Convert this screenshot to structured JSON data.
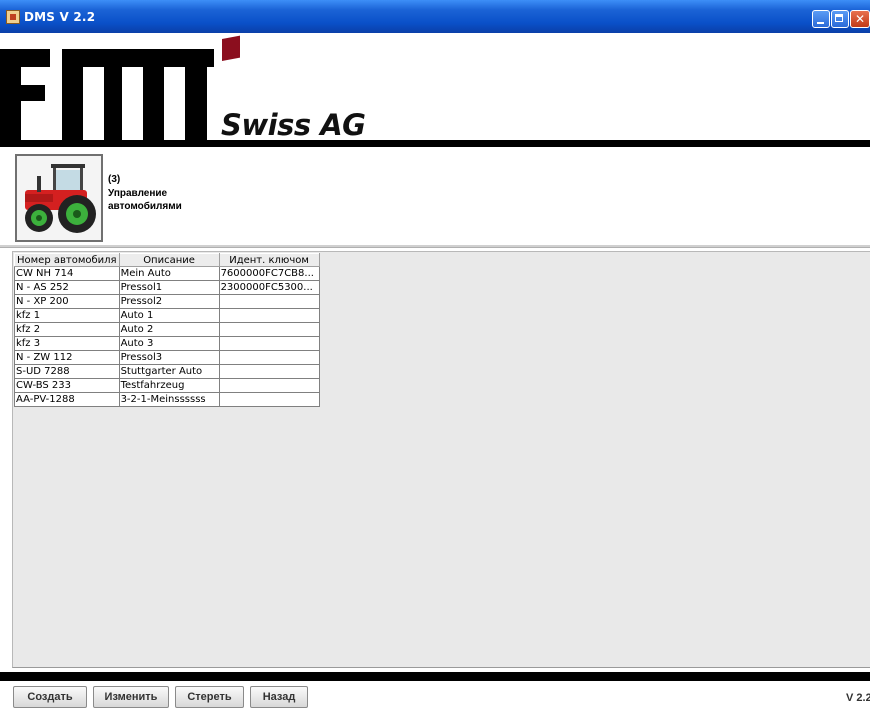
{
  "window": {
    "title": "DMS V 2.2"
  },
  "logo": {
    "company": "Swiss AG"
  },
  "module": {
    "count": "(3)",
    "title": "Управление автомобилями",
    "icon": "tractor-icon"
  },
  "table": {
    "headers": [
      "Номер автомобиля",
      "Описание",
      "Идент. ключом"
    ],
    "rows": [
      [
        "CW NH 714",
        "Mein Auto",
        "7600000FC7CB8..."
      ],
      [
        "N - AS 252",
        "Pressol1",
        "2300000FC5300..."
      ],
      [
        "N - XP 200",
        "Pressol2",
        ""
      ],
      [
        "kfz 1",
        "Auto 1",
        ""
      ],
      [
        "kfz 2",
        "Auto 2",
        ""
      ],
      [
        "kfz 3",
        "Auto 3",
        ""
      ],
      [
        "N - ZW 112",
        "Pressol3",
        ""
      ],
      [
        "S-UD 7288",
        "Stuttgarter Auto",
        ""
      ],
      [
        "CW-BS 233",
        "Testfahrzeug",
        ""
      ],
      [
        "AA-PV-1288",
        "3-2-1-Meinssssss",
        ""
      ]
    ]
  },
  "buttons": {
    "create": "Создать",
    "edit": "Изменить",
    "delete": "Стереть",
    "back": "Назад"
  },
  "footer": {
    "version": "V 2.2"
  },
  "colors": {
    "titlebar": "#0a50c8",
    "logo_accent": "#8b0e1e",
    "panel_bg": "#e9e9e9"
  }
}
